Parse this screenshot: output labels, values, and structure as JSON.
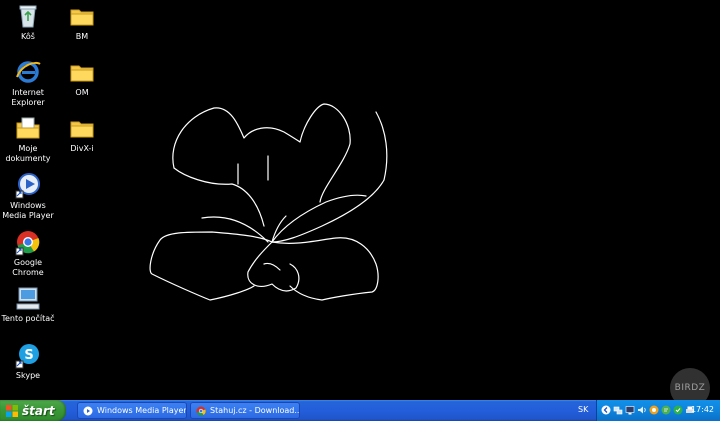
{
  "desktop": {
    "background_color": "#000000",
    "stroke_color": "#ffffff",
    "icons": [
      {
        "label": "Kôš",
        "icon": "recycle-bin-icon"
      },
      {
        "label": "BM",
        "icon": "folder-icon"
      },
      {
        "label": "Internet Explorer",
        "icon": "internet-explorer-icon"
      },
      {
        "label": "OM",
        "icon": "folder-icon"
      },
      {
        "label": "Moje dokumenty",
        "icon": "my-documents-icon"
      },
      {
        "label": "DivX-i",
        "icon": "folder-icon"
      },
      {
        "label": "Windows Media Player",
        "icon": "windows-media-player-icon"
      },
      {
        "label": "Google Chrome",
        "icon": "google-chrome-icon"
      },
      {
        "label": "Tento počítač",
        "icon": "my-computer-icon"
      },
      {
        "label": "Skype",
        "icon": "skype-icon"
      }
    ]
  },
  "watermark": {
    "text": "BIRDZ"
  },
  "taskbar": {
    "start_label": "štart",
    "tasks": [
      {
        "label": "Windows Media Player",
        "icon": "windows-media-player-icon"
      },
      {
        "label": "Stahuj.cz - Download...",
        "icon": "google-chrome-icon"
      }
    ],
    "language": "SK",
    "clock": "17:42",
    "tray_icons": [
      "back-arrow-icon",
      "network-icon",
      "monitor-icon",
      "speaker-icon",
      "shield-icon",
      "chat-icon",
      "skype-icon",
      "printer-icon"
    ]
  }
}
